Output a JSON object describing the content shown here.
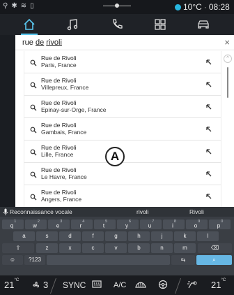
{
  "status": {
    "temperature": "10°C",
    "separator": "·",
    "time": "08:28",
    "temp_dot_color": "#27b6e0"
  },
  "tabs": [
    {
      "name": "home-icon",
      "active": true
    },
    {
      "name": "music-icon",
      "active": false
    },
    {
      "name": "phone-icon",
      "active": false
    },
    {
      "name": "apps-icon",
      "active": false
    },
    {
      "name": "car-icon",
      "active": false
    }
  ],
  "search": {
    "query_plain": "rue ",
    "query_u1": "de",
    "query_space": " ",
    "query_u2": "rivoli",
    "close": "×"
  },
  "results": [
    {
      "name": "Rue de Rivoli",
      "location": "Paris, France"
    },
    {
      "name": "Rue de Rivoli",
      "location": "Villepreux, France"
    },
    {
      "name": "Rue de Rivoli",
      "location": "Epinay-sur-Orge, France"
    },
    {
      "name": "Rue de Rivoli",
      "location": "Gambais, France"
    },
    {
      "name": "Rue de Rivoli",
      "location": "Lille, France"
    },
    {
      "name": "Rue de Rivoli",
      "location": "Le Havre, France"
    },
    {
      "name": "Rue de Rivoli",
      "location": "Angers, France"
    }
  ],
  "callout_label": "A",
  "suggestions": {
    "voice": "Reconnaissance vocale",
    "s1": "rivoli",
    "s2": "Rivoli"
  },
  "keyboard": {
    "row1": [
      {
        "k": "q",
        "n": "1"
      },
      {
        "k": "w",
        "n": "2"
      },
      {
        "k": "e",
        "n": "3"
      },
      {
        "k": "r",
        "n": "4"
      },
      {
        "k": "t",
        "n": "5"
      },
      {
        "k": "y",
        "n": "6"
      },
      {
        "k": "u",
        "n": "7"
      },
      {
        "k": "i",
        "n": "8"
      },
      {
        "k": "o",
        "n": "9"
      },
      {
        "k": "p",
        "n": "0"
      }
    ],
    "row2": [
      "a",
      "s",
      "d",
      "f",
      "g",
      "h",
      "j",
      "k",
      "l"
    ],
    "row3": [
      "z",
      "x",
      "c",
      "v",
      "b",
      "n",
      "m"
    ],
    "shift": "⇧",
    "backspace": "⌫",
    "emoji": "☺",
    "numbers": "?123",
    "lang": "⇆",
    "search": "⌕",
    "space": ""
  },
  "bottom": {
    "left_temp": "21",
    "left_unit": "°C",
    "fan_level": "3",
    "sync": "SYNC",
    "ac": "A/C",
    "right_temp": "21",
    "right_unit": "°C"
  }
}
